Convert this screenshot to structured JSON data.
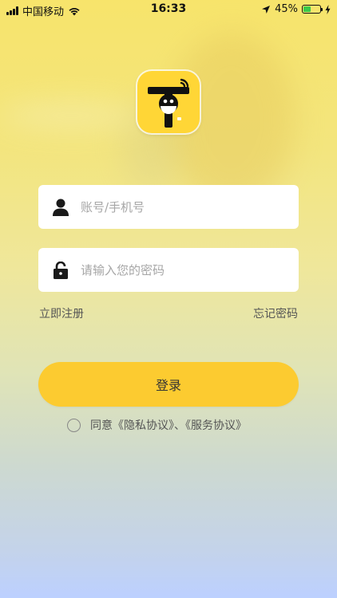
{
  "status_bar": {
    "carrier": "中国移动",
    "time": "16:33",
    "battery_percent": "45%",
    "battery_level": 0.45,
    "icons": [
      "signal-icon",
      "wifi-icon",
      "location-arrow-icon",
      "battery-icon",
      "charging-bolt-icon"
    ]
  },
  "logo": {
    "icon": "app-logo-robot-icon",
    "bg_color": "#ffd636"
  },
  "form": {
    "username": {
      "icon": "user-icon",
      "placeholder": "账号/手机号",
      "value": ""
    },
    "password": {
      "icon": "lock-icon",
      "placeholder": "请输入您的密码",
      "value": ""
    }
  },
  "links": {
    "register": "立即注册",
    "forgot_password": "忘记密码"
  },
  "login_button": {
    "label": "登录",
    "color": "#fccb30"
  },
  "agreement": {
    "prefix": "同意",
    "privacy": "《隐私协议》",
    "separator": "、",
    "service": "《服务协议》",
    "checked": false
  }
}
